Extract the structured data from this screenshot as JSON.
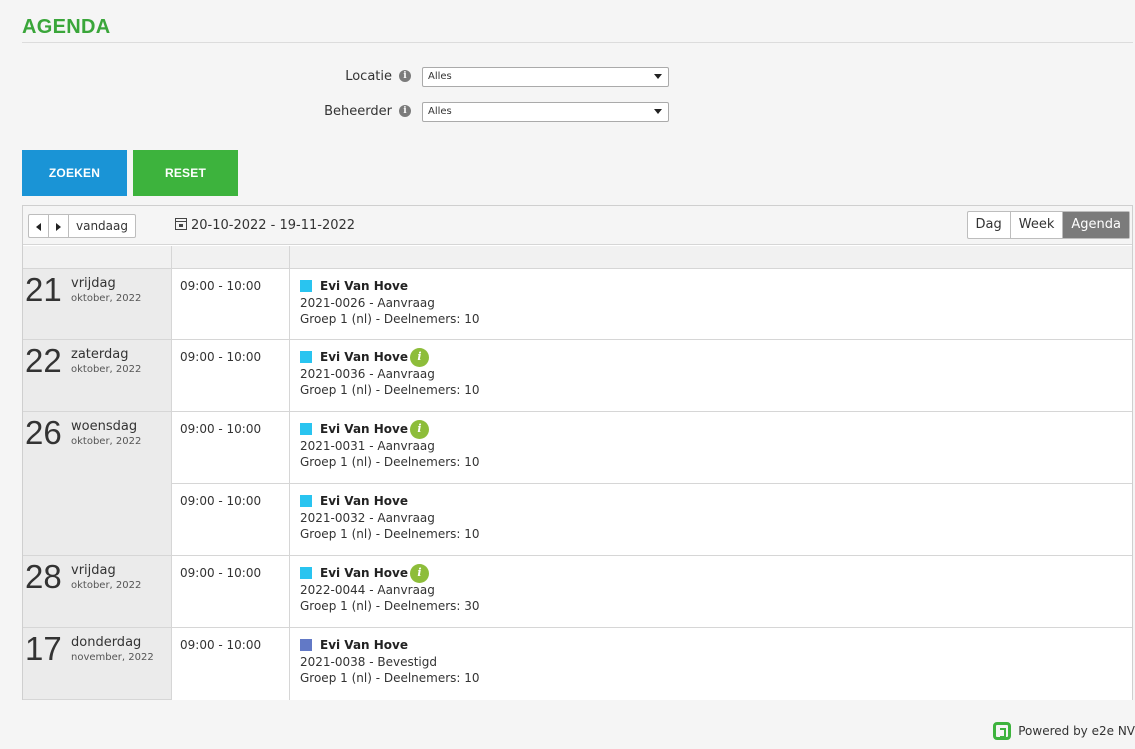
{
  "page": {
    "title": "AGENDA"
  },
  "filters": [
    {
      "label": "Locatie",
      "value": "Alles"
    },
    {
      "label": "Beheerder",
      "value": "Alles"
    }
  ],
  "buttons": {
    "search": "ZOEKEN",
    "reset": "RESET"
  },
  "toolbar": {
    "prev_icon": "caret-left-icon",
    "next_icon": "caret-right-icon",
    "today": "vandaag",
    "range": "20-10-2022 - 19-11-2022",
    "views": [
      "Dag",
      "Week",
      "Agenda"
    ],
    "active_view": "Agenda"
  },
  "colors": {
    "title": "#3aa63a",
    "search": "#1a94d6",
    "reset": "#3db33d",
    "aanvraag": "#29c4f0",
    "bevestigd": "#6279c6",
    "info": "#8dbd3a"
  },
  "days": [
    {
      "num": "21",
      "name": "vrijdag",
      "month": "oktober, 2022"
    },
    {
      "num": "22",
      "name": "zaterdag",
      "month": "oktober, 2022"
    },
    {
      "num": "26",
      "name": "woensdag",
      "month": "oktober, 2022"
    },
    {
      "num": "28",
      "name": "vrijdag",
      "month": "oktober, 2022"
    },
    {
      "num": "17",
      "name": "donderdag",
      "month": "november, 2022"
    }
  ],
  "events": [
    {
      "time": "09:00 - 10:00",
      "title": "Evi Van Hove",
      "ref": "2021-0026 - Aanvraag",
      "group": "Groep 1 (nl) - Deelnemers: 10",
      "status": "aanvraag",
      "info": false
    },
    {
      "time": "09:00 - 10:00",
      "title": "Evi Van Hove",
      "ref": "2021-0036 - Aanvraag",
      "group": "Groep 1 (nl) - Deelnemers: 10",
      "status": "aanvraag",
      "info": true
    },
    {
      "time": "09:00 - 10:00",
      "title": "Evi Van Hove",
      "ref": "2021-0031 - Aanvraag",
      "group": "Groep 1 (nl) - Deelnemers: 10",
      "status": "aanvraag",
      "info": true
    },
    {
      "time": "09:00 - 10:00",
      "title": "Evi Van Hove",
      "ref": "2021-0032 - Aanvraag",
      "group": "Groep 1 (nl) - Deelnemers: 10",
      "status": "aanvraag",
      "info": false
    },
    {
      "time": "09:00 - 10:00",
      "title": "Evi Van Hove",
      "ref": "2022-0044 - Aanvraag",
      "group": "Groep 1 (nl) - Deelnemers: 30",
      "status": "aanvraag",
      "info": true
    },
    {
      "time": "09:00 - 10:00",
      "title": "Evi Van Hove",
      "ref": "2021-0038 - Bevestigd",
      "group": "Groep 1 (nl) - Deelnemers: 10",
      "status": "bevestigd",
      "info": false
    }
  ],
  "footer": {
    "powered": "Powered by e2e NV"
  }
}
